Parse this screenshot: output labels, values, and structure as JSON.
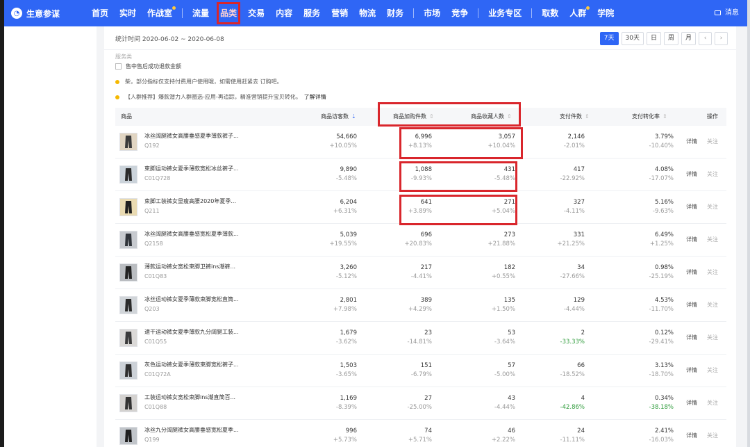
{
  "brand": {
    "name": "生意参谋",
    "logo_icon": "compass-icon"
  },
  "nav": [
    {
      "label": "首页",
      "dot": false,
      "sep_before": false,
      "boxed": false
    },
    {
      "label": "实时",
      "dot": false,
      "sep_before": false,
      "boxed": false
    },
    {
      "label": "作战室",
      "dot": true,
      "sep_before": false,
      "boxed": false
    },
    {
      "label": "流量",
      "dot": false,
      "sep_before": true,
      "boxed": false
    },
    {
      "label": "品类",
      "dot": false,
      "sep_before": false,
      "boxed": true
    },
    {
      "label": "交易",
      "dot": false,
      "sep_before": false,
      "boxed": false
    },
    {
      "label": "内容",
      "dot": false,
      "sep_before": false,
      "boxed": false
    },
    {
      "label": "服务",
      "dot": false,
      "sep_before": false,
      "boxed": false
    },
    {
      "label": "营销",
      "dot": false,
      "sep_before": false,
      "boxed": false
    },
    {
      "label": "物流",
      "dot": false,
      "sep_before": false,
      "boxed": false
    },
    {
      "label": "财务",
      "dot": false,
      "sep_before": false,
      "boxed": false
    },
    {
      "label": "市场",
      "dot": false,
      "sep_before": true,
      "boxed": false
    },
    {
      "label": "竞争",
      "dot": false,
      "sep_before": false,
      "boxed": false
    },
    {
      "label": "业务专区",
      "dot": false,
      "sep_before": true,
      "boxed": false
    },
    {
      "label": "取数",
      "dot": false,
      "sep_before": true,
      "boxed": false
    },
    {
      "label": "人群",
      "dot": true,
      "sep_before": false,
      "boxed": false
    },
    {
      "label": "学院",
      "dot": false,
      "sep_before": false,
      "boxed": false
    }
  ],
  "message": {
    "label": "消息",
    "icon": "mail-icon",
    "dot": true
  },
  "stats": {
    "period_text": "统计时间 2020-06-02 ~ 2020-06-08",
    "buttons": [
      {
        "label": "7天",
        "active": true,
        "arrow": false
      },
      {
        "label": "30天",
        "active": false,
        "arrow": false
      },
      {
        "label": "日",
        "active": false,
        "arrow": false
      },
      {
        "label": "周",
        "active": false,
        "arrow": false
      },
      {
        "label": "月",
        "active": false,
        "arrow": false
      },
      {
        "label": "‹",
        "active": false,
        "arrow": true
      },
      {
        "label": "›",
        "active": false,
        "arrow": true
      }
    ]
  },
  "filters": {
    "group_label": "服务类",
    "refund_label": "售中售后成功退款金额",
    "refund_checked": false
  },
  "notices": [
    {
      "text": "柴，部分指标仅支持付费用户使用哦，如需使用赶紧去 订购吧。",
      "link": ""
    },
    {
      "text": "【人群推荐】爆款潜力人群圈选-应用-再追踪，精准营销提升宝贝转化。",
      "link": "了解详情"
    }
  ],
  "table": {
    "headers": {
      "product": "商品",
      "visitors": "商品访客数",
      "cart": "商品加购件数",
      "fav": "商品收藏人数",
      "pay": "支付件数",
      "conv": "支付转化率",
      "ops": "操作"
    },
    "detail_label": "详情",
    "follow_label": "关注",
    "rows": [
      {
        "name": "冰丝阔腿裤女高腰垂感夏季薄款裤子...",
        "code": "Q192",
        "visitors": "54,660",
        "visitors_chg": "+10.05%",
        "cart": "6,996",
        "cart_chg": "+8.13%",
        "fav": "3,057",
        "fav_chg": "+10.04%",
        "pay": "2,146",
        "pay_chg": "-2.01%",
        "pay_green": false,
        "conv": "3.79%",
        "conv_chg": "-10.40%",
        "conv_green": false
      },
      {
        "name": "束脚运动裤女夏季薄款宽松冰丝裤子...",
        "code": "C01Q728",
        "visitors": "9,890",
        "visitors_chg": "-5.48%",
        "cart": "1,088",
        "cart_chg": "-9.93%",
        "fav": "431",
        "fav_chg": "-5.48%",
        "pay": "417",
        "pay_chg": "-22.92%",
        "pay_green": false,
        "conv": "4.08%",
        "conv_chg": "-17.07%",
        "conv_green": false
      },
      {
        "name": "束脚工装裤女显瘦高腰2020年夏季...",
        "code": "Q211",
        "visitors": "6,204",
        "visitors_chg": "+6.31%",
        "cart": "641",
        "cart_chg": "+3.89%",
        "fav": "271",
        "fav_chg": "+5.04%",
        "pay": "327",
        "pay_chg": "-4.11%",
        "pay_green": false,
        "conv": "5.16%",
        "conv_chg": "-9.63%",
        "conv_green": false
      },
      {
        "name": "冰丝阔腿裤女高腰垂感宽松夏季薄款...",
        "code": "Q2158",
        "visitors": "5,039",
        "visitors_chg": "+19.55%",
        "cart": "696",
        "cart_chg": "+20.83%",
        "fav": "273",
        "fav_chg": "+21.88%",
        "pay": "331",
        "pay_chg": "+21.25%",
        "pay_green": false,
        "conv": "6.49%",
        "conv_chg": "+1.25%",
        "conv_green": false
      },
      {
        "name": "薄款运动裤女宽松束脚卫裤ins潮裤...",
        "code": "C01Q83",
        "visitors": "3,260",
        "visitors_chg": "-5.12%",
        "cart": "217",
        "cart_chg": "-4.41%",
        "fav": "182",
        "fav_chg": "+0.55%",
        "pay": "34",
        "pay_chg": "-27.66%",
        "pay_green": false,
        "conv": "0.98%",
        "conv_chg": "-25.19%",
        "conv_green": false
      },
      {
        "name": "冰丝运动裤女夏季薄款束脚宽松直筒...",
        "code": "Q203",
        "visitors": "2,801",
        "visitors_chg": "+7.98%",
        "cart": "389",
        "cart_chg": "+4.29%",
        "fav": "135",
        "fav_chg": "+1.50%",
        "pay": "129",
        "pay_chg": "-4.44%",
        "pay_green": false,
        "conv": "4.53%",
        "conv_chg": "-11.70%",
        "conv_green": false
      },
      {
        "name": "速干运动裤女夏季薄款九分阔腿工装...",
        "code": "C01Q55",
        "visitors": "1,679",
        "visitors_chg": "-3.62%",
        "cart": "23",
        "cart_chg": "-14.81%",
        "fav": "53",
        "fav_chg": "-3.64%",
        "pay": "2",
        "pay_chg": "-33.33%",
        "pay_green": true,
        "conv": "0.12%",
        "conv_chg": "-29.41%",
        "conv_green": false
      },
      {
        "name": "灰色运动裤女夏季薄款束脚宽松裤子...",
        "code": "C01Q72A",
        "visitors": "1,503",
        "visitors_chg": "-3.65%",
        "cart": "151",
        "cart_chg": "-6.79%",
        "fav": "57",
        "fav_chg": "-5.00%",
        "pay": "66",
        "pay_chg": "-18.52%",
        "pay_green": false,
        "conv": "3.13%",
        "conv_chg": "-18.70%",
        "conv_green": false
      },
      {
        "name": "工装运动裤女宽松束脚ins潮直筒百...",
        "code": "C01Q88",
        "visitors": "1,169",
        "visitors_chg": "-8.39%",
        "cart": "27",
        "cart_chg": "-25.00%",
        "fav": "43",
        "fav_chg": "-4.44%",
        "pay": "4",
        "pay_chg": "-42.86%",
        "pay_green": true,
        "conv": "0.34%",
        "conv_chg": "-38.18%",
        "conv_green": true
      },
      {
        "name": "冰丝九分阔腿裤女高腰垂感宽松夏季...",
        "code": "Q199",
        "visitors": "996",
        "visitors_chg": "+5.73%",
        "cart": "74",
        "cart_chg": "+5.71%",
        "fav": "46",
        "fav_chg": "+2.22%",
        "pay": "24",
        "pay_chg": "-11.11%",
        "pay_green": false,
        "conv": "2.41%",
        "conv_chg": "-16.03%",
        "conv_green": false
      }
    ]
  },
  "colors": {
    "brand_blue": "#2f66f5",
    "highlight_red": "#d9262c",
    "positive_green": "#2e9b3a",
    "notice_yellow": "#f5b800"
  }
}
